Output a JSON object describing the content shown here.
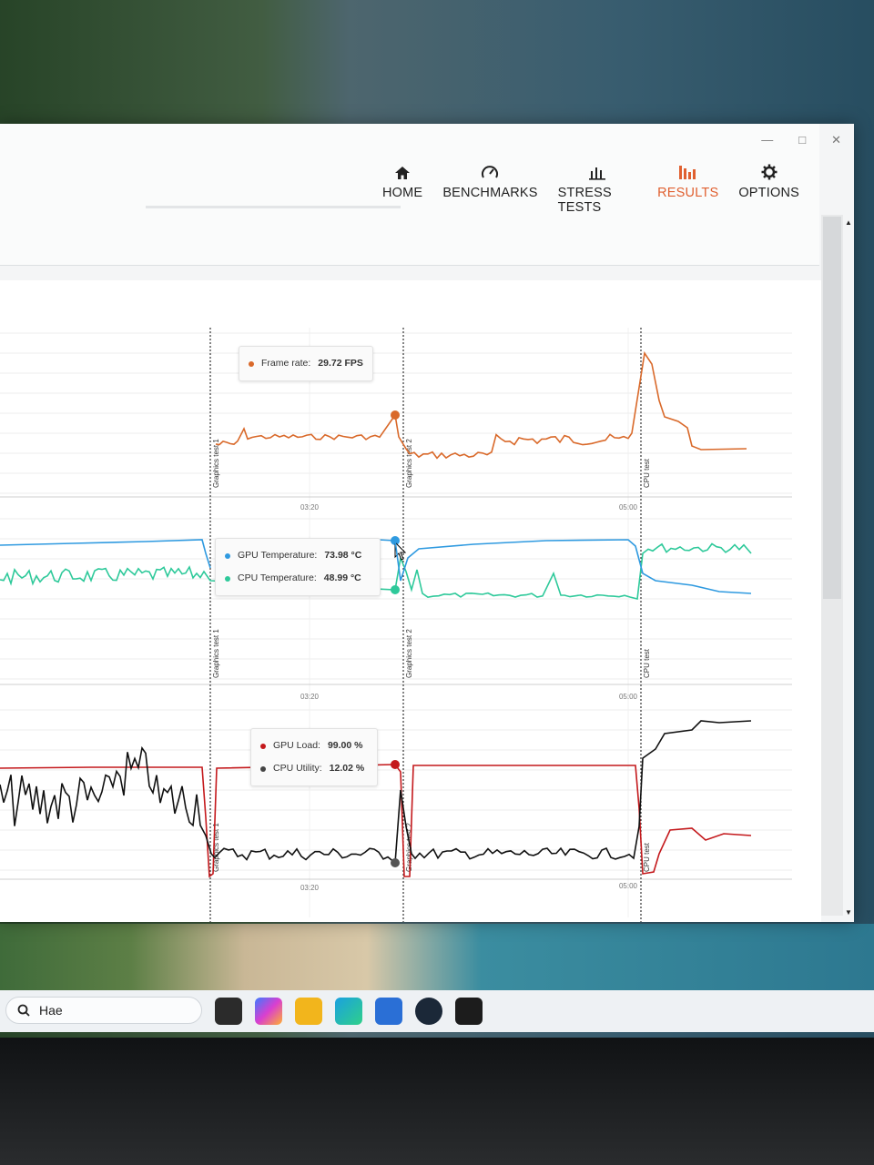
{
  "nav": {
    "items": [
      {
        "label": "HOME",
        "icon": "home-icon",
        "active": false
      },
      {
        "label": "BENCHMARKS",
        "icon": "gauge-icon",
        "active": false
      },
      {
        "label": "STRESS TESTS",
        "icon": "bar-chart-icon",
        "active": false
      },
      {
        "label": "RESULTS",
        "icon": "results-icon",
        "active": true
      },
      {
        "label": "OPTIONS",
        "icon": "gear-icon",
        "active": false
      }
    ],
    "active_color": "#e06030"
  },
  "markers": {
    "graphics_test_1": "Graphics test 1",
    "graphics_test_2": "Graphics test 2",
    "cpu_test": "CPU test"
  },
  "time_ticks": [
    "03:20",
    "05:00"
  ],
  "tooltips": {
    "fps": {
      "label": "Frame rate:",
      "value": "29.72 FPS"
    },
    "temps": [
      {
        "label": "GPU Temperature:",
        "value": "73.98 °C"
      },
      {
        "label": "CPU Temperature:",
        "value": "48.99 °C"
      }
    ],
    "loads": [
      {
        "label": "GPU Load:",
        "value": "99.00 %"
      },
      {
        "label": "CPU Utility:",
        "value": "12.02 %"
      }
    ]
  },
  "colors": {
    "fps": "#d9692a",
    "gpu_temp": "#2f9ae0",
    "cpu_temp": "#2ec99a",
    "gpu_load": "#c4191c",
    "cpu_util": "#111111"
  },
  "taskbar": {
    "search_text": "Hae"
  },
  "chart_data": [
    {
      "type": "line",
      "series": [
        {
          "name": "Frame rate",
          "unit": "FPS",
          "values": [
            29.72
          ]
        }
      ],
      "x_ticks": [
        "03:20",
        "05:00"
      ]
    },
    {
      "type": "line",
      "series": [
        {
          "name": "GPU Temperature",
          "unit": "°C",
          "values": [
            73.98
          ]
        },
        {
          "name": "CPU Temperature",
          "unit": "°C",
          "values": [
            48.99
          ]
        }
      ],
      "x_ticks": [
        "03:20",
        "05:00"
      ]
    },
    {
      "type": "line",
      "series": [
        {
          "name": "GPU Load",
          "unit": "%",
          "values": [
            99.0
          ]
        },
        {
          "name": "CPU Utility",
          "unit": "%",
          "values": [
            12.02
          ]
        }
      ],
      "x_ticks": [
        "03:20",
        "05:00"
      ]
    }
  ]
}
